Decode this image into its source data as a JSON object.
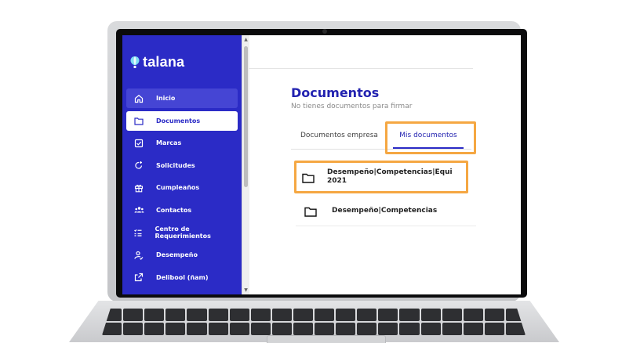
{
  "app": {
    "logo_text": "talana"
  },
  "sidebar": {
    "items": [
      {
        "label": "Inicio",
        "icon": "home-icon"
      },
      {
        "label": "Documentos",
        "icon": "folder-icon"
      },
      {
        "label": "Marcas",
        "icon": "checkbox-icon"
      },
      {
        "label": "Solicitudes",
        "icon": "refresh-plus-icon"
      },
      {
        "label": "Cumpleaños",
        "icon": "gift-icon"
      },
      {
        "label": "Contactos",
        "icon": "people-icon"
      },
      {
        "label": "Centro de Requerimientos",
        "icon": "checklist-icon"
      },
      {
        "label": "Desempeño",
        "icon": "user-check-icon"
      },
      {
        "label": "Delibool (ñam)",
        "icon": "external-link-icon"
      }
    ]
  },
  "main": {
    "title": "Documentos",
    "subtitle": "No tienes documentos para firmar",
    "tabs": [
      {
        "label": "Documentos empresa",
        "active": false
      },
      {
        "label": "Mis documentos",
        "active": true
      }
    ],
    "documents": [
      {
        "name_line1": "Desempeño|Competencias|Equi",
        "name_line2": "2021"
      },
      {
        "name_line1": "Desempeño|Competencias",
        "name_line2": ""
      }
    ]
  },
  "colors": {
    "sidebar_bg": "#2b2bc6",
    "accent": "#2222b0",
    "highlight": "#f5a742"
  }
}
